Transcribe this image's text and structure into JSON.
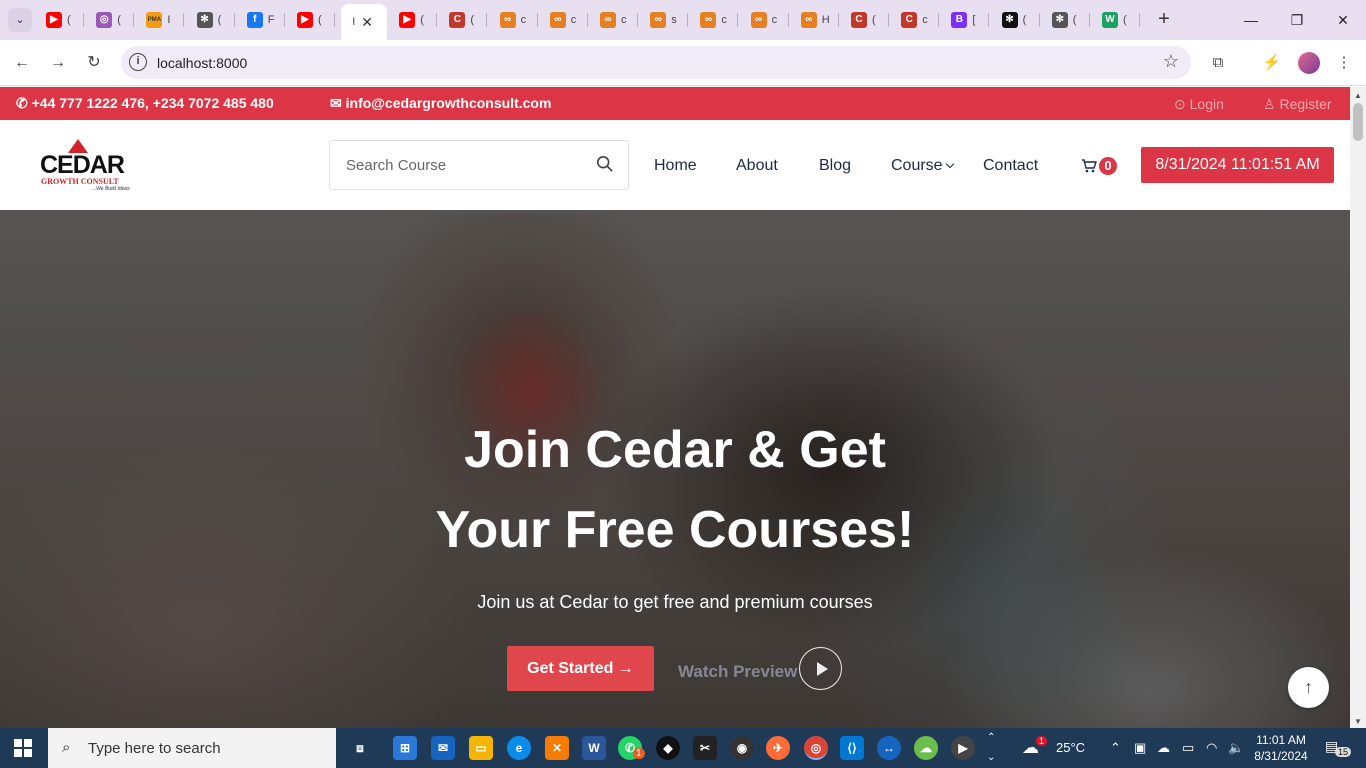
{
  "browser": {
    "tabs": [
      {
        "color": "#ff0000",
        "glyph": "▶",
        "title": "("
      },
      {
        "color": "#9b59b6",
        "glyph": "◎",
        "title": "("
      },
      {
        "color": "#f39c12",
        "glyph": "PMA",
        "title": "I"
      },
      {
        "color": "#555555",
        "glyph": "✻",
        "title": "("
      },
      {
        "color": "#1877f2",
        "glyph": "f",
        "title": "F"
      },
      {
        "color": "#ff0000",
        "glyph": "▶",
        "title": "("
      },
      {
        "color": "#ffffff",
        "glyph": "",
        "title": "I",
        "active": true
      },
      {
        "color": "#ff0000",
        "glyph": "▶",
        "title": "("
      },
      {
        "color": "#c0392b",
        "glyph": "C",
        "title": "("
      },
      {
        "color": "#e67e22",
        "glyph": "∞",
        "title": "c"
      },
      {
        "color": "#e67e22",
        "glyph": "∞",
        "title": "c"
      },
      {
        "color": "#e67e22",
        "glyph": "∞",
        "title": "c"
      },
      {
        "color": "#e67e22",
        "glyph": "∞",
        "title": "s"
      },
      {
        "color": "#e67e22",
        "glyph": "∞",
        "title": "c"
      },
      {
        "color": "#e67e22",
        "glyph": "∞",
        "title": "c"
      },
      {
        "color": "#e67e22",
        "glyph": "∞",
        "title": "H"
      },
      {
        "color": "#c0392b",
        "glyph": "C",
        "title": "("
      },
      {
        "color": "#c0392b",
        "glyph": "C",
        "title": "c"
      },
      {
        "color": "#7b2ff7",
        "glyph": "B",
        "title": "["
      },
      {
        "color": "#111111",
        "glyph": "✻",
        "title": "("
      },
      {
        "color": "#555555",
        "glyph": "✻",
        "title": "("
      },
      {
        "color": "#1aa260",
        "glyph": "W",
        "title": "("
      }
    ],
    "active_close": "✕",
    "new_tab": "+",
    "url": "localhost:8000"
  },
  "topbar": {
    "phone": "+44 777 1222 476, +234 7072 485 480",
    "email": "info@cedargrowthconsult.com",
    "login": "Login",
    "register": "Register"
  },
  "header": {
    "logo_name": "CEDAR",
    "logo_sub": "GROWTH CONSULT",
    "logo_tag": "...We Build Ideas",
    "search_placeholder": "Search Course",
    "nav": [
      "Home",
      "About",
      "Blog",
      "Course",
      "Contact"
    ],
    "cart_count": "0",
    "datetime": "8/31/2024 11:01:51 AM"
  },
  "hero": {
    "title_line1": "Join Cedar & Get",
    "title_line2": "Your Free Courses!",
    "subtitle": "Join us at Cedar to get free and premium courses",
    "cta": "Get Started",
    "cta_arrow": "→",
    "watch": "Watch Preview",
    "to_top": "↑"
  },
  "taskbar": {
    "search_text": "Type here to search",
    "weather_temp": "25°C",
    "weather_badge": "1",
    "whatsapp_badge": "1",
    "time": "11:01 AM",
    "date": "8/31/2024",
    "notif_count": "15"
  },
  "colors": {
    "brand_red": "#dc3545",
    "nav_text": "#1c2a48",
    "taskbar": "#1f3a56"
  }
}
